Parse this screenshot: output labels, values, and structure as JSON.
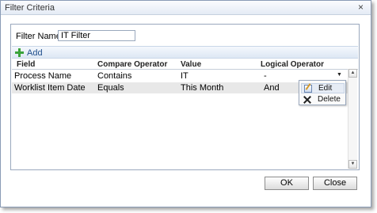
{
  "window": {
    "title": "Filter Criteria",
    "close_glyph": "×"
  },
  "form": {
    "filter_name_label": "Filter Name:",
    "filter_name_value": "IT Filter"
  },
  "toolbar": {
    "add_label": "Add"
  },
  "grid": {
    "headers": [
      "Field",
      "Compare Operator",
      "Value",
      "Logical Operator"
    ],
    "rows": [
      {
        "field": "Process Name",
        "compare": "Contains",
        "value": "IT",
        "logical": "-"
      },
      {
        "field": "Worklist Item Date",
        "compare": "Equals",
        "value": "This Month",
        "logical": "And"
      }
    ]
  },
  "context_menu": {
    "edit_label": "Edit",
    "delete_label": "Delete"
  },
  "buttons": {
    "ok_label": "OK",
    "close_label": "Close"
  },
  "icons": {
    "add": "plus-icon",
    "edit": "edit-icon",
    "delete": "delete-icon",
    "close": "close-icon"
  },
  "colors": {
    "add_plus": "#3aa33a",
    "link_text": "#1f4e8c",
    "selected_row": "#e8e8e8"
  }
}
